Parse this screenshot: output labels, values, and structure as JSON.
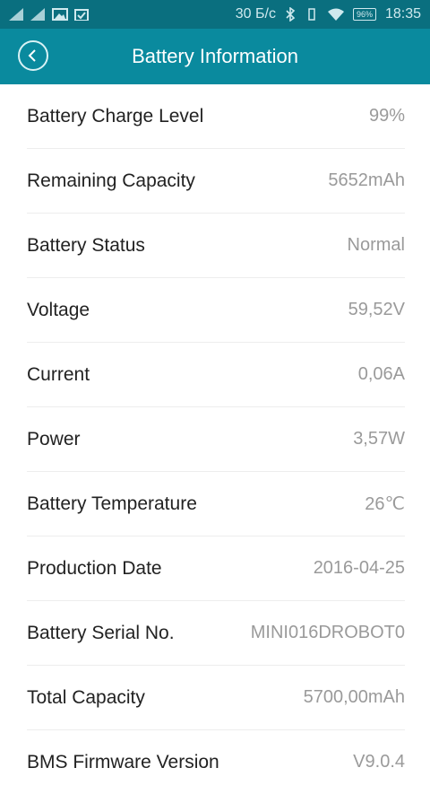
{
  "status": {
    "speed": "30 Б/с",
    "battery_pct": "96%",
    "time": "18:35"
  },
  "header": {
    "title": "Battery Information"
  },
  "items": [
    {
      "label": "Battery Charge Level",
      "value": "99%"
    },
    {
      "label": "Remaining Capacity",
      "value": "5652mAh"
    },
    {
      "label": "Battery Status",
      "value": "Normal"
    },
    {
      "label": "Voltage",
      "value": "59,52V"
    },
    {
      "label": "Current",
      "value": "0,06A"
    },
    {
      "label": "Power",
      "value": "3,57W"
    },
    {
      "label": "Battery Temperature",
      "value": "26℃"
    },
    {
      "label": "Production Date",
      "value": "2016-04-25"
    },
    {
      "label": "Battery Serial No.",
      "value": "MINI016DROBOT0"
    },
    {
      "label": "Total Capacity",
      "value": "5700,00mAh"
    },
    {
      "label": "BMS Firmware Version",
      "value": "V9.0.4"
    }
  ],
  "colors": {
    "appbar": "#0a8a9e",
    "statusbar": "#0a6f7f"
  }
}
